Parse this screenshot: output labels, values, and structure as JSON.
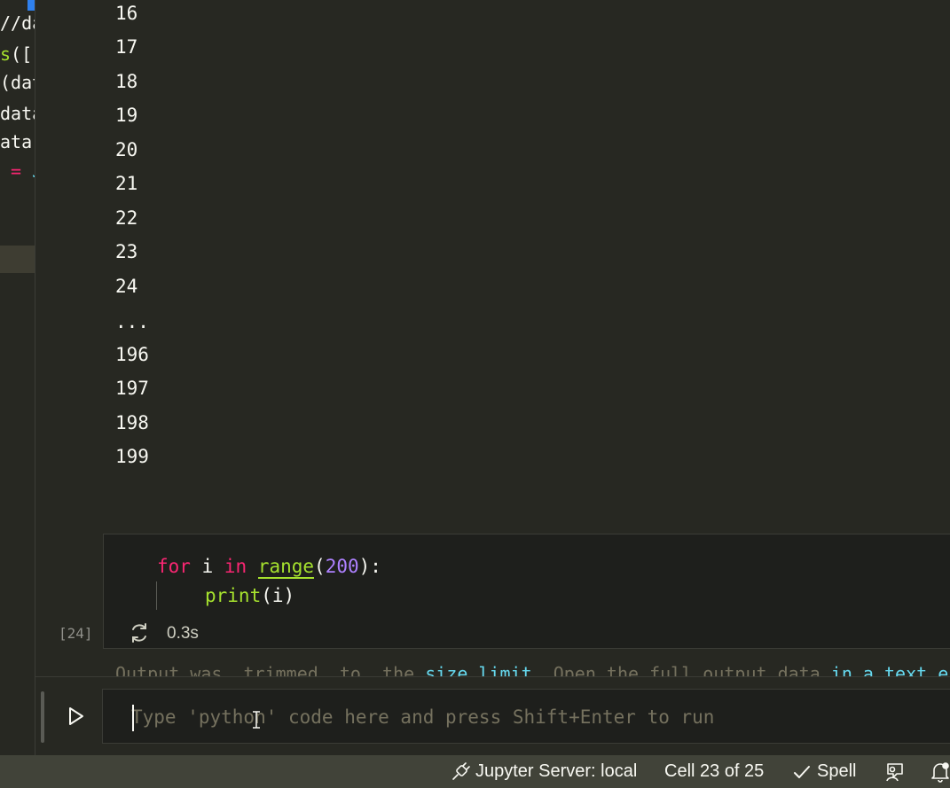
{
  "left_code_fragments": [
    {
      "text": "//da"
    },
    {
      "text": "s([",
      "color": "green"
    },
    {
      "text": "(dat"
    },
    {
      "text": "data"
    },
    {
      "text": "ata"
    },
    {
      "text": " = J"
    }
  ],
  "output": {
    "lines": [
      "16",
      "17",
      "18",
      "19",
      "20",
      "21",
      "22",
      "23",
      "24",
      "...",
      "196",
      "197",
      "198",
      "199"
    ]
  },
  "cell": {
    "line1": {
      "kw_for": "for",
      "var": " i ",
      "kw_in": "in",
      "space": " ",
      "fn_range": "range",
      "open": "(",
      "num": "200",
      "close": "):"
    },
    "line2": {
      "fn_print": "print",
      "args": "(i)"
    },
    "execution_count": "[24]",
    "execution_time": "0.3s"
  },
  "faint_text": {
    "part1": "Output was  trimmed  to  the ",
    "link1": "size limit",
    "part2": ". Open the full output data ",
    "link2": "in a text editor"
  },
  "input": {
    "placeholder": "Type 'python' code here and press Shift+Enter to run",
    "value": ""
  },
  "status": {
    "jupyter_server": "Jupyter Server: local",
    "cell_position": "Cell 23 of 25",
    "spell": "Spell"
  },
  "icons": {
    "run": "play-icon",
    "busy": "sync-icon",
    "server": "plug-icon",
    "spell": "check-icon",
    "feedback": "person-feedback-icon",
    "notifications": "bell-icon"
  },
  "colors": {
    "background": "#272822",
    "keyword": "#f92672",
    "function": "#a6e22e",
    "number": "#ae81ff",
    "status_bar": "#414339"
  }
}
